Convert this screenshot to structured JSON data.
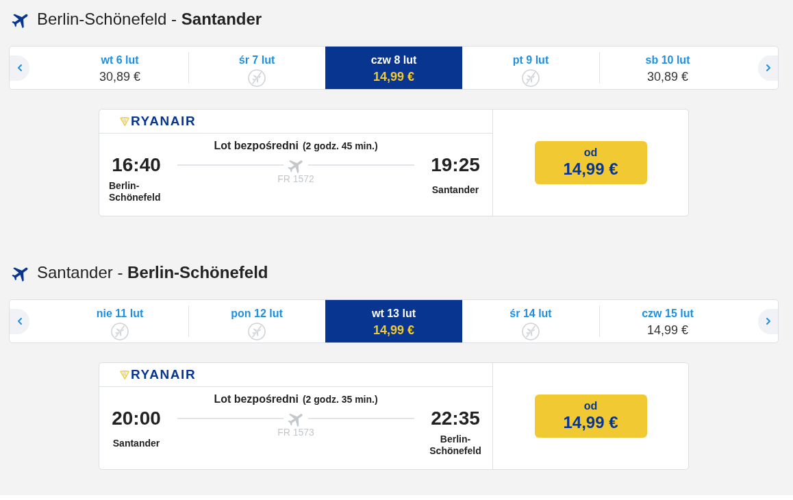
{
  "legs": [
    {
      "heading": "Berlin-Schönefeld - **Santander**",
      "days": [
        {
          "label": "wt 6 lut",
          "kind": "fare",
          "price": "30,89 €",
          "selected": false
        },
        {
          "label": "śr 7 lut",
          "kind": "no-flight",
          "selected": false
        },
        {
          "label": "czw 8 lut",
          "kind": "fare",
          "price": "14,99 €",
          "selected": true
        },
        {
          "label": "pt 9 lut",
          "kind": "no-flight",
          "selected": false
        },
        {
          "label": "sb 10 lut",
          "kind": "fare",
          "price": "30,89 €",
          "selected": false
        }
      ],
      "flight": {
        "airline": "RYANAIR",
        "route_type": "Lot bezpośredni",
        "duration": "(2 godz. 45 min.)",
        "departure": {
          "time": "16:40",
          "city": "Berlin-Schönefeld"
        },
        "flight_number": "FR 1572",
        "arrival": {
          "time": "19:25",
          "city": "Santander"
        },
        "price_prefix": "od",
        "price": "14,99 €"
      }
    },
    {
      "heading": "Santander - **Berlin-Schönefeld**",
      "days": [
        {
          "label": "nie 11 lut",
          "kind": "no-flight",
          "selected": false
        },
        {
          "label": "pon 12 lut",
          "kind": "no-flight",
          "selected": false
        },
        {
          "label": "wt 13 lut",
          "kind": "fare",
          "price": "14,99 €",
          "selected": true
        },
        {
          "label": "śr 14 lut",
          "kind": "no-flight",
          "selected": false
        },
        {
          "label": "czw 15 lut",
          "kind": "fare",
          "price": "14,99 €",
          "selected": false
        }
      ],
      "flight": {
        "airline": "RYANAIR",
        "route_type": "Lot bezpośredni",
        "duration": "(2 godz. 35 min.)",
        "departure": {
          "time": "20:00",
          "city": "Santander"
        },
        "flight_number": "FR 1573",
        "arrival": {
          "time": "22:35",
          "city": "Berlin-Schönefeld"
        },
        "price_prefix": "od",
        "price": "14,99 €"
      }
    }
  ]
}
